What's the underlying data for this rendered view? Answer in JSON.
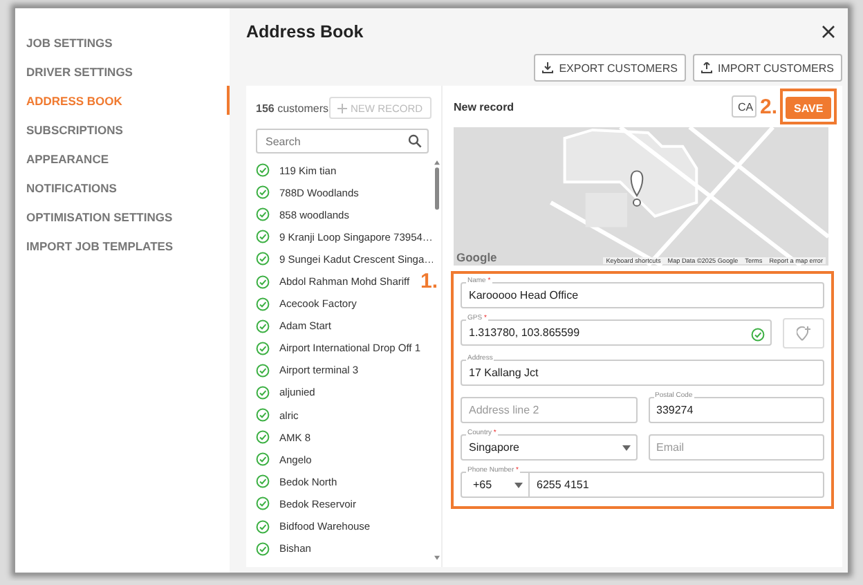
{
  "sidebar": {
    "items": [
      {
        "label": "JOB SETTINGS",
        "selected": false
      },
      {
        "label": "DRIVER SETTINGS",
        "selected": false
      },
      {
        "label": "ADDRESS BOOK",
        "selected": true
      },
      {
        "label": "SUBSCRIPTIONS",
        "selected": false
      },
      {
        "label": "APPEARANCE",
        "selected": false
      },
      {
        "label": "NOTIFICATIONS",
        "selected": false
      },
      {
        "label": "OPTIMISATION SETTINGS",
        "selected": false
      },
      {
        "label": "IMPORT JOB TEMPLATES",
        "selected": false
      }
    ]
  },
  "header": {
    "title": "Address Book"
  },
  "toolbar": [
    {
      "label": "EXPORT CUSTOMERS",
      "kind": "export"
    },
    {
      "label": "IMPORT CUSTOMERS",
      "kind": "import"
    }
  ],
  "customers": {
    "count": "156",
    "count_label": "customers",
    "new_record": {
      "label": "NEW RECORD",
      "disabled": true
    },
    "search": {
      "placeholder": "Search"
    },
    "items": [
      {
        "name": "119 Kim tian",
        "verified": true
      },
      {
        "name": "788D Woodlands",
        "verified": true
      },
      {
        "name": "858 woodlands",
        "verified": true
      },
      {
        "name": "9 Kranji Loop Singapore 73954…",
        "verified": true
      },
      {
        "name": "9 Sungei Kadut Crescent Singa…",
        "verified": true
      },
      {
        "name": "Abdol Rahman Mohd Shariff",
        "verified": true
      },
      {
        "name": "Acecook Factory",
        "verified": true
      },
      {
        "name": "Adam Start",
        "verified": true
      },
      {
        "name": "Airport International Drop Off 1",
        "verified": true
      },
      {
        "name": "Airport terminal 3",
        "verified": true
      },
      {
        "name": "aljunied",
        "verified": true
      },
      {
        "name": "alric",
        "verified": true
      },
      {
        "name": "AMK 8",
        "verified": true
      },
      {
        "name": "Angelo",
        "verified": true
      },
      {
        "name": "Bedok North",
        "verified": true
      },
      {
        "name": "Bedok Reservoir",
        "verified": true
      },
      {
        "name": "Bidfood Warehouse",
        "verified": true
      },
      {
        "name": "Bishan",
        "verified": true
      }
    ]
  },
  "record": {
    "title": "New record",
    "cancel": "CA",
    "save": "SAVE",
    "map_attribution": {
      "logo": "Google",
      "links": [
        "Keyboard shortcuts",
        "Map Data ©2025 Google",
        "Terms",
        "Report a map error"
      ]
    },
    "form": {
      "required_mark": "*",
      "name": {
        "label": "Name",
        "required": true,
        "value": "Karooooo Head Office"
      },
      "gps": {
        "label": "GPS",
        "required": true,
        "value": "1.313780, 103.865599",
        "valid": true
      },
      "address": {
        "label": "Address",
        "required": false,
        "value": "17 Kallang Jct"
      },
      "address_line_2": {
        "placeholder": "Address line 2"
      },
      "postal_code": {
        "label": "Postal Code",
        "required": false,
        "value": "339274"
      },
      "country": {
        "label": "Country",
        "required": true,
        "value": "Singapore"
      },
      "email": {
        "placeholder": "Email"
      },
      "phone": {
        "label": "Phone Number",
        "required": true,
        "code": "+65",
        "value": "6255 4151"
      }
    }
  },
  "annotations": [
    {
      "label": "1."
    },
    {
      "label": "2."
    }
  ]
}
